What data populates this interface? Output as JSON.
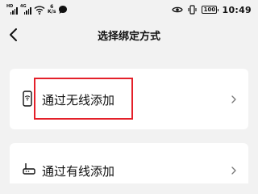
{
  "status_bar": {
    "network_left": "HD",
    "network_right": "4G",
    "net_speed_value": "6",
    "net_speed_unit": "K/s",
    "battery": "100",
    "time": "10:49"
  },
  "header": {
    "title": "选择绑定方式",
    "back_icon": "back-arrow-icon"
  },
  "options": [
    {
      "label": "通过无线添加",
      "icon": "wireless-device-icon",
      "chevron": "chevron-right-icon"
    },
    {
      "label": "通过有线添加",
      "icon": "router-icon",
      "chevron": "chevron-right-icon"
    }
  ],
  "colors": {
    "background": "#f2f2f2",
    "card": "#ffffff",
    "text": "#111111",
    "highlight": "#e4202a"
  }
}
